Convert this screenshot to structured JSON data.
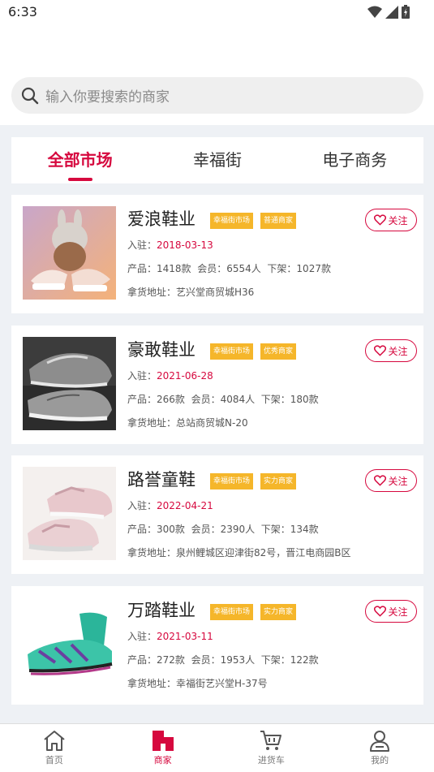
{
  "status_bar": {
    "time": "6:33"
  },
  "search": {
    "placeholder": "输入你要搜索的商家"
  },
  "tabs": [
    {
      "label": "全部市场",
      "active": true
    },
    {
      "label": "幸福街",
      "active": false
    },
    {
      "label": "电子商务",
      "active": false
    }
  ],
  "labels": {
    "join_prefix": "入驻：",
    "products_prefix": "产品：",
    "members_prefix": "会员：",
    "listed_prefix": "下架：",
    "address_prefix": "拿货地址：",
    "follow": "关注"
  },
  "merchants": [
    {
      "name": "爱浪鞋业",
      "tags": [
        "幸福街市场",
        "普通商家"
      ],
      "join_date": "2018-03-13",
      "products": "1418款",
      "members": "6554人",
      "listed": "1027款",
      "address": "艺兴堂商贸城H36"
    },
    {
      "name": "豪敢鞋业",
      "tags": [
        "幸福街市场",
        "优秀商家"
      ],
      "join_date": "2021-06-28",
      "products": "266款",
      "members": "4084人",
      "listed": "180款",
      "address": "总站商贸城N-20"
    },
    {
      "name": "路誉童鞋",
      "tags": [
        "幸福街市场",
        "实力商家"
      ],
      "join_date": "2022-04-21",
      "products": "300款",
      "members": "2390人",
      "listed": "134款",
      "address": "泉州鲤城区迎津街82号，晋江电商园B区"
    },
    {
      "name": "万踏鞋业",
      "tags": [
        "幸福街市场",
        "实力商家"
      ],
      "join_date": "2021-03-11",
      "products": "272款",
      "members": "1953人",
      "listed": "122款",
      "address": "幸福街艺兴堂H-37号"
    }
  ],
  "bottom_nav": [
    {
      "label": "首页",
      "icon": "home-icon",
      "active": false
    },
    {
      "label": "商家",
      "icon": "store-icon",
      "active": true
    },
    {
      "label": "进货车",
      "icon": "cart-icon",
      "active": false
    },
    {
      "label": "我的",
      "icon": "user-icon",
      "active": false
    }
  ],
  "colors": {
    "accent": "#d6083e",
    "tag": "#f5b62a",
    "background": "#eef1f5"
  }
}
